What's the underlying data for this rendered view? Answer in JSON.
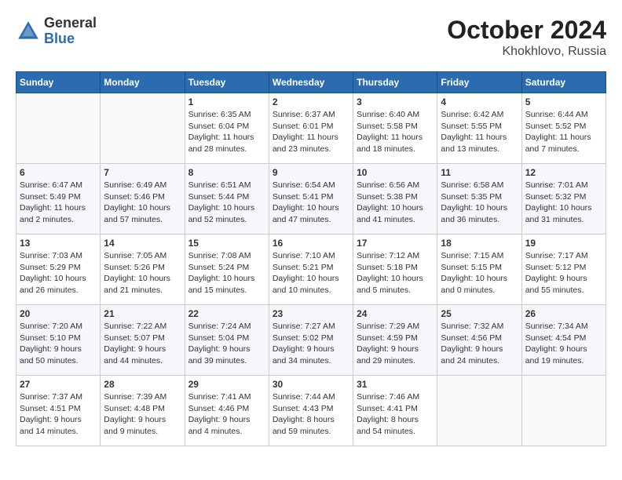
{
  "header": {
    "logo_general": "General",
    "logo_blue": "Blue",
    "month_title": "October 2024",
    "location": "Khokhlovo, Russia"
  },
  "calendar": {
    "days_of_week": [
      "Sunday",
      "Monday",
      "Tuesday",
      "Wednesday",
      "Thursday",
      "Friday",
      "Saturday"
    ],
    "weeks": [
      [
        {
          "day": "",
          "content": ""
        },
        {
          "day": "",
          "content": ""
        },
        {
          "day": "1",
          "content": "Sunrise: 6:35 AM\nSunset: 6:04 PM\nDaylight: 11 hours\nand 28 minutes."
        },
        {
          "day": "2",
          "content": "Sunrise: 6:37 AM\nSunset: 6:01 PM\nDaylight: 11 hours\nand 23 minutes."
        },
        {
          "day": "3",
          "content": "Sunrise: 6:40 AM\nSunset: 5:58 PM\nDaylight: 11 hours\nand 18 minutes."
        },
        {
          "day": "4",
          "content": "Sunrise: 6:42 AM\nSunset: 5:55 PM\nDaylight: 11 hours\nand 13 minutes."
        },
        {
          "day": "5",
          "content": "Sunrise: 6:44 AM\nSunset: 5:52 PM\nDaylight: 11 hours\nand 7 minutes."
        }
      ],
      [
        {
          "day": "6",
          "content": "Sunrise: 6:47 AM\nSunset: 5:49 PM\nDaylight: 11 hours\nand 2 minutes."
        },
        {
          "day": "7",
          "content": "Sunrise: 6:49 AM\nSunset: 5:46 PM\nDaylight: 10 hours\nand 57 minutes."
        },
        {
          "day": "8",
          "content": "Sunrise: 6:51 AM\nSunset: 5:44 PM\nDaylight: 10 hours\nand 52 minutes."
        },
        {
          "day": "9",
          "content": "Sunrise: 6:54 AM\nSunset: 5:41 PM\nDaylight: 10 hours\nand 47 minutes."
        },
        {
          "day": "10",
          "content": "Sunrise: 6:56 AM\nSunset: 5:38 PM\nDaylight: 10 hours\nand 41 minutes."
        },
        {
          "day": "11",
          "content": "Sunrise: 6:58 AM\nSunset: 5:35 PM\nDaylight: 10 hours\nand 36 minutes."
        },
        {
          "day": "12",
          "content": "Sunrise: 7:01 AM\nSunset: 5:32 PM\nDaylight: 10 hours\nand 31 minutes."
        }
      ],
      [
        {
          "day": "13",
          "content": "Sunrise: 7:03 AM\nSunset: 5:29 PM\nDaylight: 10 hours\nand 26 minutes."
        },
        {
          "day": "14",
          "content": "Sunrise: 7:05 AM\nSunset: 5:26 PM\nDaylight: 10 hours\nand 21 minutes."
        },
        {
          "day": "15",
          "content": "Sunrise: 7:08 AM\nSunset: 5:24 PM\nDaylight: 10 hours\nand 15 minutes."
        },
        {
          "day": "16",
          "content": "Sunrise: 7:10 AM\nSunset: 5:21 PM\nDaylight: 10 hours\nand 10 minutes."
        },
        {
          "day": "17",
          "content": "Sunrise: 7:12 AM\nSunset: 5:18 PM\nDaylight: 10 hours\nand 5 minutes."
        },
        {
          "day": "18",
          "content": "Sunrise: 7:15 AM\nSunset: 5:15 PM\nDaylight: 10 hours\nand 0 minutes."
        },
        {
          "day": "19",
          "content": "Sunrise: 7:17 AM\nSunset: 5:12 PM\nDaylight: 9 hours\nand 55 minutes."
        }
      ],
      [
        {
          "day": "20",
          "content": "Sunrise: 7:20 AM\nSunset: 5:10 PM\nDaylight: 9 hours\nand 50 minutes."
        },
        {
          "day": "21",
          "content": "Sunrise: 7:22 AM\nSunset: 5:07 PM\nDaylight: 9 hours\nand 44 minutes."
        },
        {
          "day": "22",
          "content": "Sunrise: 7:24 AM\nSunset: 5:04 PM\nDaylight: 9 hours\nand 39 minutes."
        },
        {
          "day": "23",
          "content": "Sunrise: 7:27 AM\nSunset: 5:02 PM\nDaylight: 9 hours\nand 34 minutes."
        },
        {
          "day": "24",
          "content": "Sunrise: 7:29 AM\nSunset: 4:59 PM\nDaylight: 9 hours\nand 29 minutes."
        },
        {
          "day": "25",
          "content": "Sunrise: 7:32 AM\nSunset: 4:56 PM\nDaylight: 9 hours\nand 24 minutes."
        },
        {
          "day": "26",
          "content": "Sunrise: 7:34 AM\nSunset: 4:54 PM\nDaylight: 9 hours\nand 19 minutes."
        }
      ],
      [
        {
          "day": "27",
          "content": "Sunrise: 7:37 AM\nSunset: 4:51 PM\nDaylight: 9 hours\nand 14 minutes."
        },
        {
          "day": "28",
          "content": "Sunrise: 7:39 AM\nSunset: 4:48 PM\nDaylight: 9 hours\nand 9 minutes."
        },
        {
          "day": "29",
          "content": "Sunrise: 7:41 AM\nSunset: 4:46 PM\nDaylight: 9 hours\nand 4 minutes."
        },
        {
          "day": "30",
          "content": "Sunrise: 7:44 AM\nSunset: 4:43 PM\nDaylight: 8 hours\nand 59 minutes."
        },
        {
          "day": "31",
          "content": "Sunrise: 7:46 AM\nSunset: 4:41 PM\nDaylight: 8 hours\nand 54 minutes."
        },
        {
          "day": "",
          "content": ""
        },
        {
          "day": "",
          "content": ""
        }
      ]
    ]
  }
}
